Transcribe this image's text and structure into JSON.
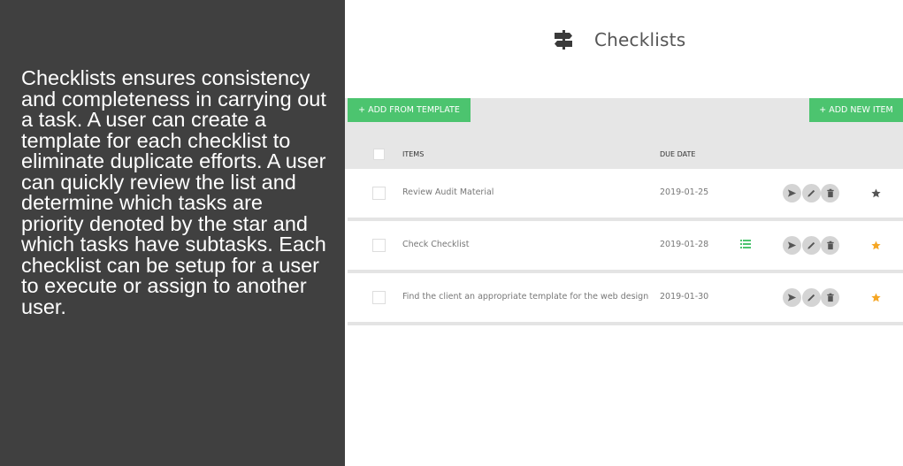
{
  "description": "Checklists ensures consistency and completeness in carrying out a task. A user can create a template for each checklist to eliminate duplicate efforts. A user can quickly review the list and determine which tasks are priority denoted by the star and which tasks have subtasks. Each checklist can be setup for a user to execute or assign to another user.",
  "header": {
    "title": "Checklists",
    "icon": "signpost-icon"
  },
  "toolbar": {
    "add_from_template": "+ ADD FROM TEMPLATE",
    "add_new_item": "+ ADD NEW ITEM",
    "button_color": "#4cc46f"
  },
  "table": {
    "columns": {
      "items": "ITEMS",
      "due_date": "DUE DATE"
    },
    "rows": [
      {
        "name": "Review Audit Material",
        "due": "2019-01-25",
        "has_subtasks": false,
        "priority": false
      },
      {
        "name": "Check Checklist",
        "due": "2019-01-28",
        "has_subtasks": true,
        "priority": true
      },
      {
        "name": "Find the client an appropriate template for the web design",
        "due": "2019-01-30",
        "has_subtasks": false,
        "priority": true
      }
    ],
    "actions": [
      "send-icon",
      "edit-icon",
      "delete-icon"
    ]
  },
  "colors": {
    "left_panel": "#404040",
    "accent_green": "#4cc46f",
    "star_priority": "#f5a623",
    "star_default": "#555555"
  }
}
